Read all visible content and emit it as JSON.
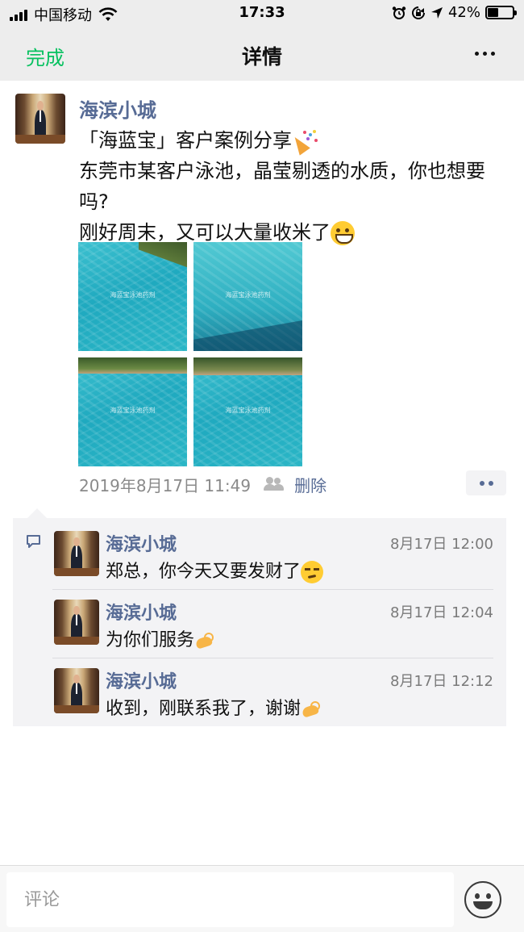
{
  "status_bar": {
    "carrier": "中国移动",
    "time": "17:33",
    "battery": "42%",
    "battery_level": 0.42
  },
  "nav": {
    "done_label": "完成",
    "title": "详情",
    "more_icon": "more-icon"
  },
  "post": {
    "author": "海滨小城",
    "lines": [
      "「海蓝宝」客户案例分享",
      "东莞市某客户泳池，晶莹剔透的水质，你也想要吗?",
      "刚好周末，又可以大量收米了"
    ],
    "photos": [
      {
        "watermark": "海蓝宝泳池药剂"
      },
      {
        "watermark": "海蓝宝泳池药剂"
      },
      {
        "watermark": "海蓝宝泳池药剂"
      },
      {
        "watermark": "海蓝宝泳池药剂"
      }
    ],
    "timestamp": "2019年8月17日 11:49",
    "delete_label": "删除"
  },
  "comments": [
    {
      "author": "海滨小城",
      "time": "8月17日 12:00",
      "text": "郑总，你今天又要发财了"
    },
    {
      "author": "海滨小城",
      "time": "8月17日 12:04",
      "text": "为你们服务"
    },
    {
      "author": "海滨小城",
      "time": "8月17日 12:12",
      "text": "收到，刚联系我了，谢谢"
    }
  ],
  "input": {
    "placeholder": "评论"
  },
  "colors": {
    "accent_green": "#07c160",
    "link_blue": "#576b95",
    "bar_gray": "#ededed",
    "comment_bg": "#f3f3f5"
  }
}
